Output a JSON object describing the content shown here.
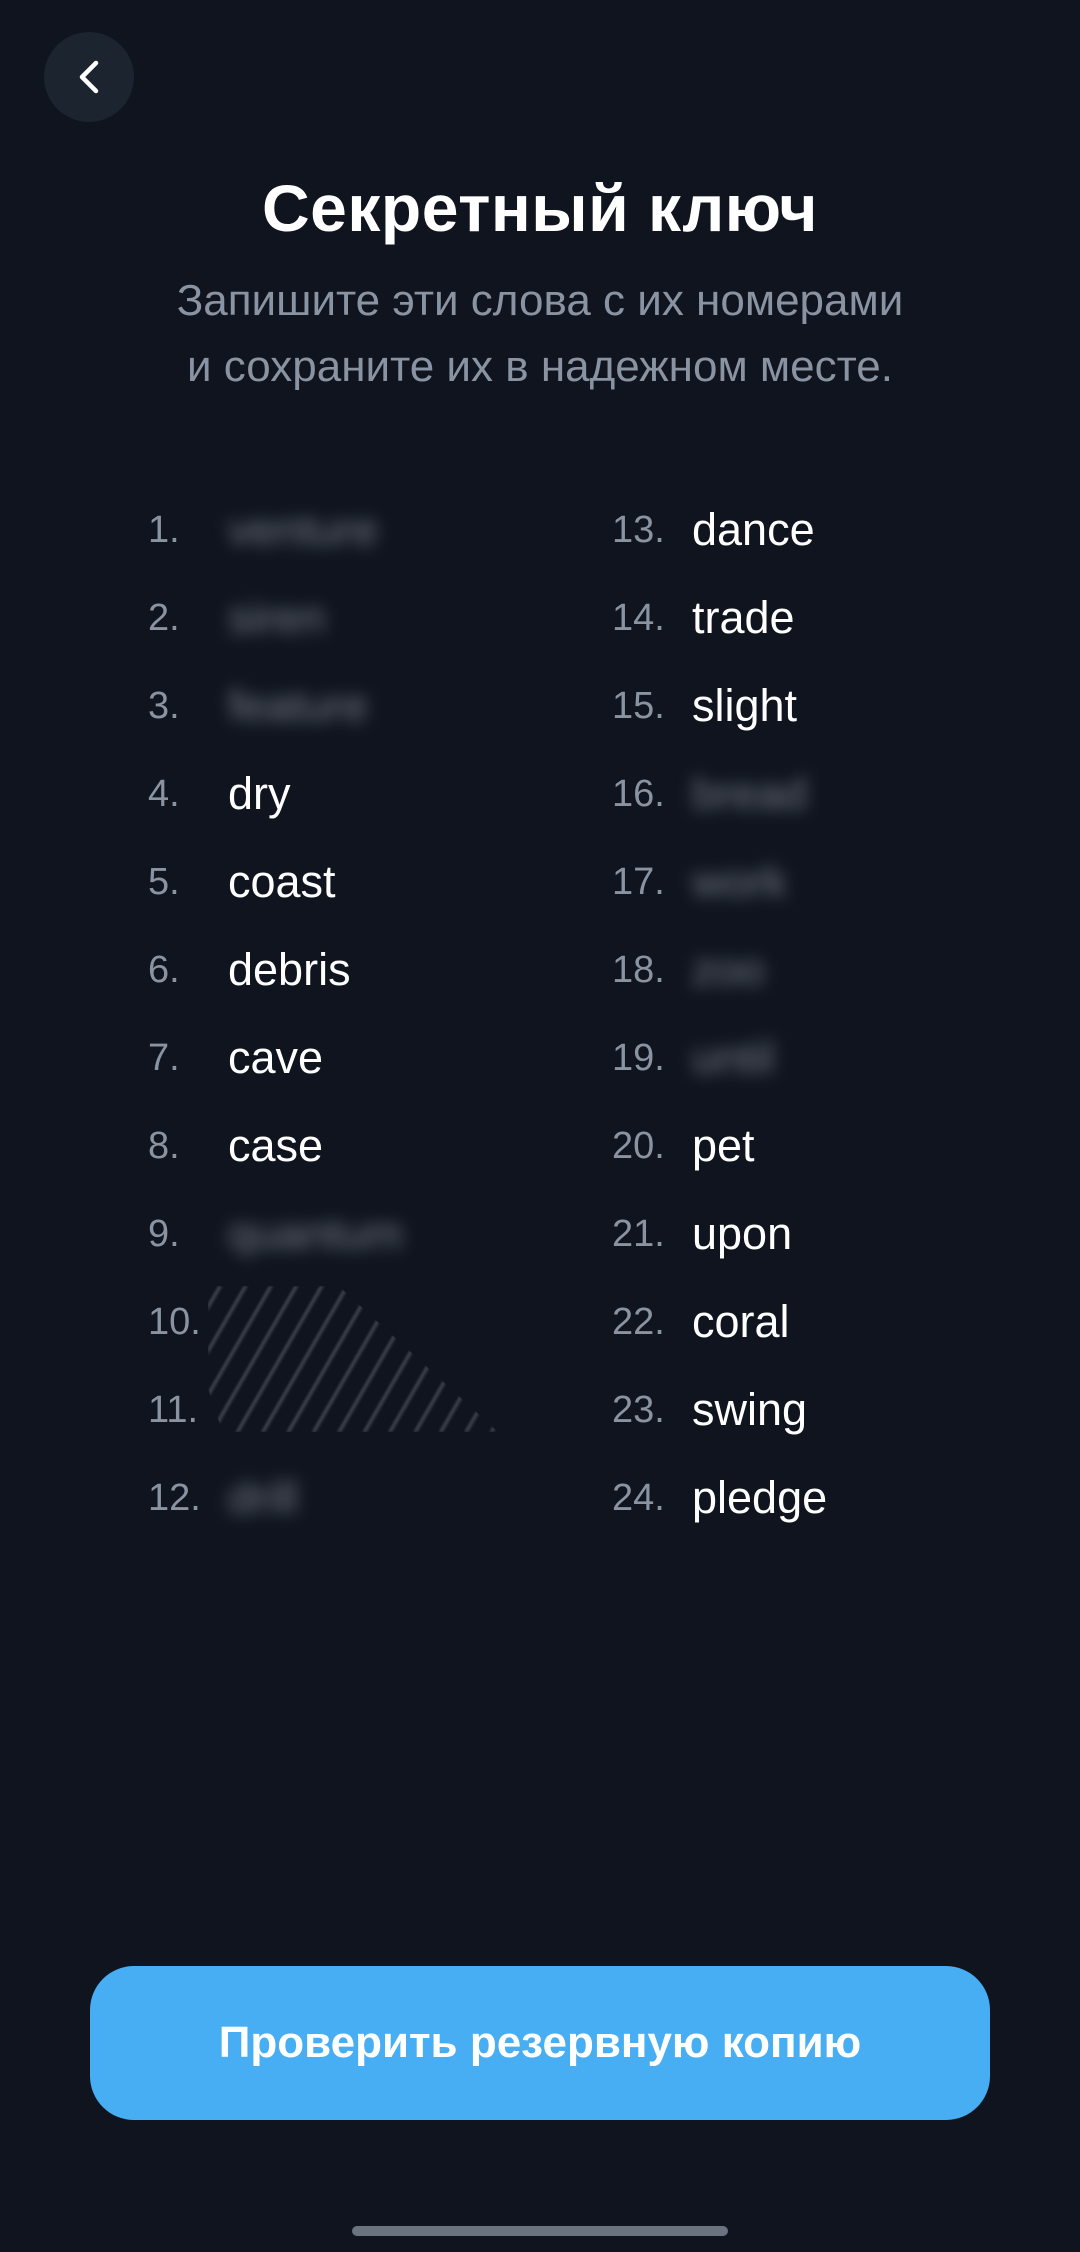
{
  "header": {
    "back_icon": "chevron-left-icon",
    "title": "Секретный ключ",
    "subtitle_line1": "Запишите эти слова с их номерами",
    "subtitle_line2": "и сохраните их в надежном месте."
  },
  "words_left": [
    {
      "num": "1.",
      "word": "venture",
      "hidden": true
    },
    {
      "num": "2.",
      "word": "siren",
      "hidden": true
    },
    {
      "num": "3.",
      "word": "feature",
      "hidden": true
    },
    {
      "num": "4.",
      "word": "dry",
      "hidden": false
    },
    {
      "num": "5.",
      "word": "coast",
      "hidden": false
    },
    {
      "num": "6.",
      "word": "debris",
      "hidden": false
    },
    {
      "num": "7.",
      "word": "cave",
      "hidden": false
    },
    {
      "num": "8.",
      "word": "case",
      "hidden": false
    },
    {
      "num": "9.",
      "word": "quantum",
      "hidden": true
    },
    {
      "num": "10.",
      "word": "",
      "hidden": true
    },
    {
      "num": "11.",
      "word": "",
      "hidden": true
    },
    {
      "num": "12.",
      "word": "drill",
      "hidden": true
    }
  ],
  "words_right": [
    {
      "num": "13.",
      "word": "dance",
      "hidden": false
    },
    {
      "num": "14.",
      "word": "trade",
      "hidden": false
    },
    {
      "num": "15.",
      "word": "slight",
      "hidden": false
    },
    {
      "num": "16.",
      "word": "bread",
      "hidden": true
    },
    {
      "num": "17.",
      "word": "work",
      "hidden": true
    },
    {
      "num": "18.",
      "word": "zoo",
      "hidden": true
    },
    {
      "num": "19.",
      "word": "until",
      "hidden": true
    },
    {
      "num": "20.",
      "word": "pet",
      "hidden": false
    },
    {
      "num": "21.",
      "word": "upon",
      "hidden": false
    },
    {
      "num": "22.",
      "word": "coral",
      "hidden": false
    },
    {
      "num": "23.",
      "word": "swing",
      "hidden": false
    },
    {
      "num": "24.",
      "word": "pledge",
      "hidden": false
    }
  ],
  "footer": {
    "verify_button_label": "Проверить резервную копию"
  },
  "colors": {
    "background": "#0f141e",
    "accent": "#47aef3",
    "muted_text": "#8a93a2"
  }
}
